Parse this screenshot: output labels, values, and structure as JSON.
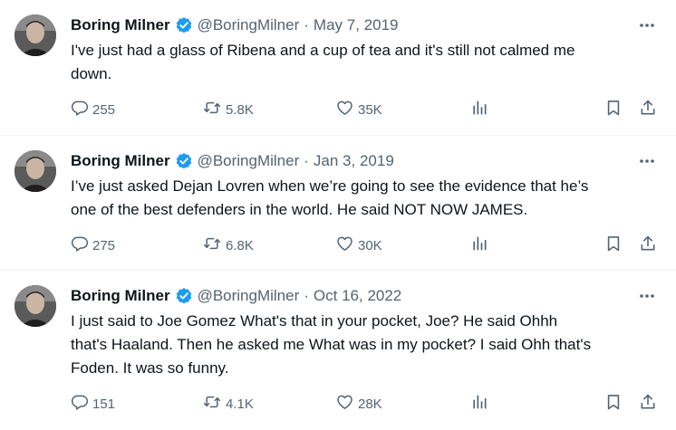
{
  "tweets": [
    {
      "name": "Boring Milner",
      "handle": "@BoringMilner",
      "separator": "·",
      "date": "May 7, 2019",
      "text": "I've just had a glass of Ribena and a cup of tea and it's still not calmed me\ndown.",
      "replies": "255",
      "retweets": "5.8K",
      "likes": "35K"
    },
    {
      "name": "Boring Milner",
      "handle": "@BoringMilner",
      "separator": "·",
      "date": "Jan 3, 2019",
      "text": "I’ve just asked Dejan Lovren when we’re going to see the evidence that he’s\none of the best defenders in the world. He said NOT NOW JAMES.",
      "replies": "275",
      "retweets": "6.8K",
      "likes": "30K"
    },
    {
      "name": "Boring Milner",
      "handle": "@BoringMilner",
      "separator": "·",
      "date": "Oct 16, 2022",
      "text": "I just said to Joe Gomez What's that in your pocket, Joe? He said Ohhh\nthat's Haaland. Then he asked me What was in my pocket? I said Ohh that's\nFoden. It was so funny.",
      "replies": "151",
      "retweets": "4.1K",
      "likes": "28K"
    }
  ],
  "colors": {
    "verified_badge": "#1d9bf0",
    "secondary_text": "#536471",
    "divider": "#eff3f4"
  },
  "icons": {
    "verified": "verified-badge-icon",
    "more": "more-icon",
    "reply": "reply-icon",
    "retweet": "retweet-icon",
    "like": "like-icon",
    "views": "views-icon",
    "bookmark": "bookmark-icon",
    "share": "share-icon"
  }
}
